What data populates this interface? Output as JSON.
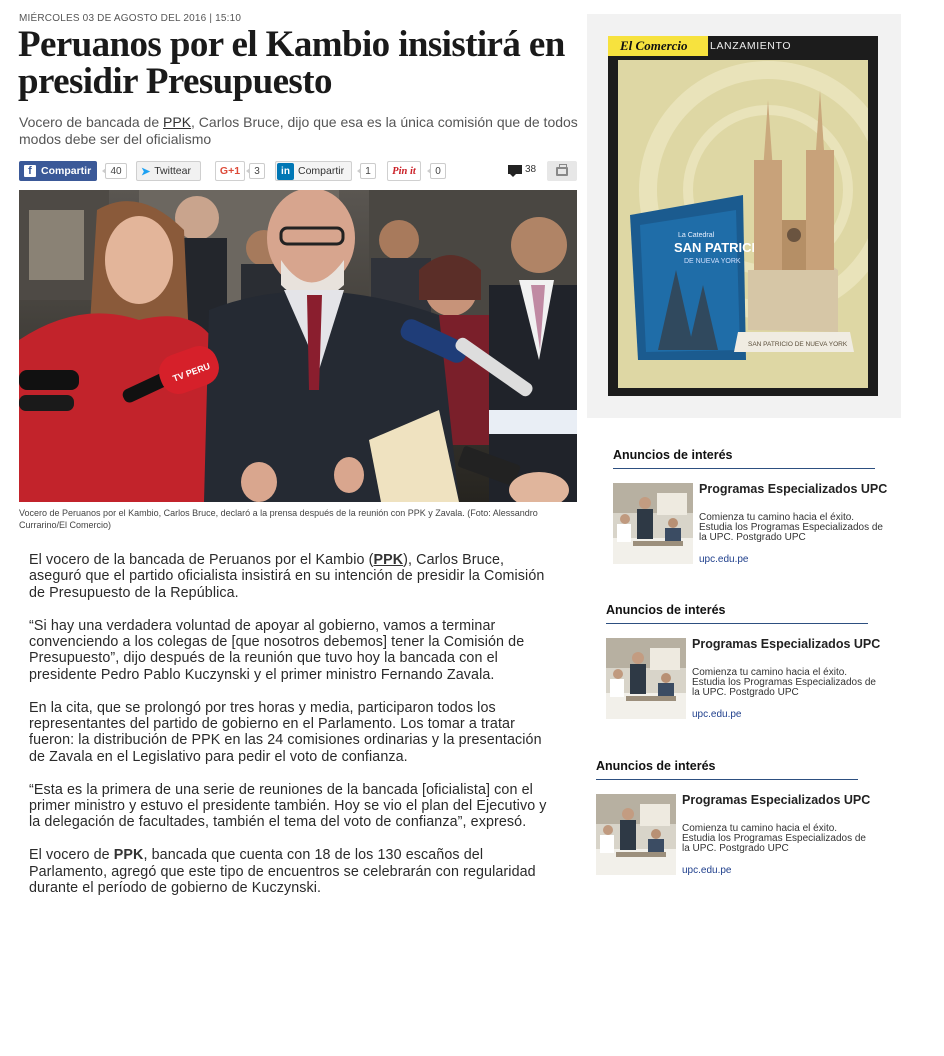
{
  "article": {
    "dateline": "MIÉRCOLES 03 DE AGOSTO DEL 2016 | 15:10",
    "headline": "Peruanos por el Kambio insistirá en presidir Presupuesto",
    "subtitle": {
      "before": "Vocero de bancada de ",
      "keyword": "PPK",
      "after": ", Carlos Bruce, dijo que esa es la única comisión que de todos modos debe ser del oficialismo"
    },
    "share": {
      "facebook_label": "Compartir",
      "facebook_icon": "f",
      "facebook_count": "40",
      "twitter_label": "Twittear",
      "twitter_icon": "➤",
      "twitter_count": "",
      "gplus_label": "G+1",
      "gplus_count": "3",
      "linkedin_label": "Compartir",
      "linkedin_icon": "in",
      "linkedin_count": "1",
      "pinterest_label": "Pin it",
      "pinterest_count": "0",
      "comments_count": "38"
    },
    "photo_caption": "Vocero de Peruanos por el Kambio, Carlos Bruce, declaró a la prensa después de la reunión con PPK y Zavala. (Foto: Alessandro Currarino/El Comercio)",
    "photo_mic_label": "TV PERU",
    "body": {
      "p1_before": "El vocero de la bancada de Peruanos por el Kambio (",
      "p1_keyword": "PPK",
      "p1_after": "), Carlos Bruce, aseguró que el partido oficialista insistirá en su intención de presidir la Comisión de Presupuesto de la República.",
      "p2": "“Si hay una verdadera voluntad de apoyar al gobierno, vamos a terminar convenciendo a los colegas de [que nosotros debemos] tener la Comisión de Presupuesto”, dijo después de la reunión que tuvo hoy la bancada con el presidente Pedro Pablo Kuczynski y el primer ministro Fernando Zavala.",
      "p3": "En la cita, que se prolongó por tres horas y media, participaron todos los representantes del partido de gobierno en el Parlamento. Los tomar a tratar fueron: la distribución de PPK en las 24 comisiones ordinarias y la presentación de Zavala en el Legislativo para pedir el voto de confianza.",
      "p4": "“Esta es la primera de una serie de reuniones de la bancada [oficialista] con el primer ministro y estuvo el presidente también. Hoy se vio el plan del Ejecutivo y la delegación de facultades, también el tema del voto de confianza”, expresó.",
      "p5_before": "El vocero de ",
      "p5_keyword": "PPK",
      "p5_after": ", bancada que cuenta con 18 de los 130 escaños del Parlamento, agregó que este tipo de encuentros se celebrarán con regularidad durante el período de gobierno de Kuczynski."
    }
  },
  "ad": {
    "brand": "El Comercio",
    "tag": "LANZAMIENTO",
    "book_small": "La Catedral",
    "book_title": "SAN PATRICIO",
    "book_subtitle": "DE NUEVA YORK",
    "base_label": "SAN PATRICIO DE NUEVA YORK"
  },
  "sponsored": [
    {
      "title": "Anuncios de interés",
      "headline": "Programas Especializados UPC",
      "description": "Comienza tu camino hacia el éxito. Estudia los Programas Especializados de la UPC. Postgrado UPC",
      "link": "upc.edu.pe"
    },
    {
      "title": "Anuncios de interés",
      "headline": "Programas Especializados UPC",
      "description": "Comienza tu camino hacia el éxito. Estudia los Programas Especializados de la UPC. Postgrado UPC",
      "link": "upc.edu.pe"
    },
    {
      "title": "Anuncios de interés",
      "headline": "Programas Especializados UPC",
      "description": "Comienza tu camino hacia el éxito. Estudia los Programas Especializados de la UPC. Postgrado UPC",
      "link": "upc.edu.pe"
    }
  ],
  "colors": {
    "facebook": "#3b5998",
    "linkedin": "#0077b5",
    "pinterest": "#cb2027",
    "gplus": "#dd4b39",
    "ad_brand": "#f7e23e",
    "sponsored_rule": "#2d4f80",
    "link": "#1f3f8c"
  }
}
